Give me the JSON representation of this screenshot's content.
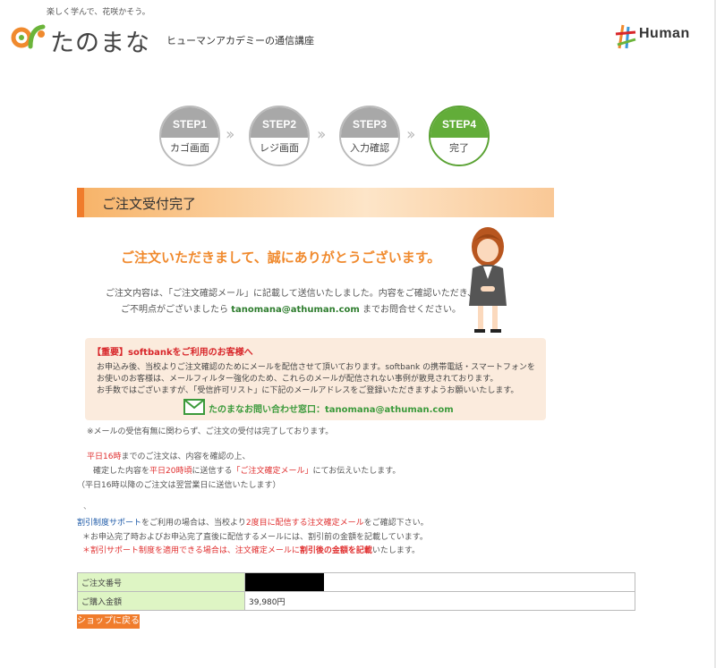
{
  "header": {
    "tagline": "楽しく学んで、花咲かそう。",
    "logo_text": "たのまな",
    "logo_sub": "ヒューマンアカデミーの通信講座",
    "brand": "Human"
  },
  "steps": [
    {
      "label": "STEP1",
      "name": "カゴ画面",
      "active": false
    },
    {
      "label": "STEP2",
      "name": "レジ画面",
      "active": false
    },
    {
      "label": "STEP3",
      "name": "入力確認",
      "active": false
    },
    {
      "label": "STEP4",
      "name": "完了",
      "active": true
    }
  ],
  "section_title": "ご注文受付完了",
  "thanks": "ご注文いただきまして、誠にありがとうございます。",
  "confirm": {
    "line1": "ご注文内容は、「ご注文確認メール」に記載して送信いたしました。内容をご確認いただき、",
    "line2_pre": "ご不明点がございましたら",
    "email": "tanomana@athuman.com",
    "line2_post": "までお問合せください。"
  },
  "notice": {
    "title": "【重要】softbankをご利用のお客様へ",
    "lines": [
      "お申込み後、当校よりご注文確認のためにメールを配信させて頂いております。softbank の携帯電話・スマートフォンを",
      "お使いのお客様は、メールフィルター強化のため、これらのメールが配信されない事例が散見されております。",
      "お手数ではございますが、「受信許可リスト」に下記のメールアドレスをご登録いただきますようお願いいたします。"
    ],
    "contact": "たのまなお問い合わせ窓口：tanomana@athuman.com"
  },
  "notes": {
    "mail_note": "※メールの受信有無に関わらず、ご注文の受付は完了しております。",
    "weekday_a": "平日16時",
    "weekday_b": "までのご注文は、内容を確認の上、",
    "confirmed_a": "確定した内容を",
    "confirmed_b": "平日20時頃",
    "confirmed_c": "に送信する",
    "confirmed_d": "「ご注文確定メール」",
    "confirmed_e": "にてお伝えいたします。",
    "after16": "（平日16時以降のご注文は翌営業日に送信いたします）",
    "dot": "、",
    "support_a": "割引制度サポート",
    "support_b": "をご利用の場合は、当校より",
    "support_c": "2度目に配信する注文確定メール",
    "support_d": "をご確認下さい。",
    "bullet1": "＊お申込完了時およびお申込完了直後に配信するメールには、割引前の金額を記載しています。",
    "bullet2_a": "＊割引サポート制度を適用できる場合は、注文確定メールに",
    "bullet2_b": "割引後の金額を記載",
    "bullet2_c": "いたします。"
  },
  "order_table": [
    {
      "key": "ご注文番号",
      "value": ""
    },
    {
      "key": "ご購入金額",
      "value": "39,980円"
    }
  ],
  "back_button": "ショップに戻る"
}
